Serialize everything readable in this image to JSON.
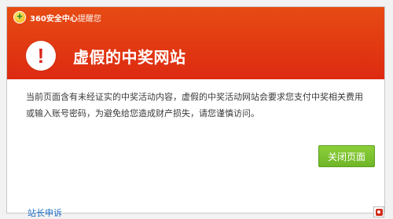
{
  "header": {
    "brand_name": "360安全中心",
    "brand_suffix": "提醒您",
    "title": "虚假的中奖网站",
    "alert_icon_glyph": "!"
  },
  "body": {
    "message": "当前页面含有未经证实的中奖活动内容，虚假的中奖活动网站会要求您支付中奖相关费用或输入账号密码，为避免给您造成财产损失，请您谨慎访问。"
  },
  "actions": {
    "close_label": "关闭页面"
  },
  "footer": {
    "appeal_link": "站长申诉"
  },
  "icons": {
    "brand_logo": "360-logo-icon",
    "alert": "exclamation-icon",
    "corner": "report-icon"
  },
  "colors": {
    "header_red": "#dd2a12",
    "button_green": "#6fb627",
    "link_blue": "#1e6fc7"
  }
}
